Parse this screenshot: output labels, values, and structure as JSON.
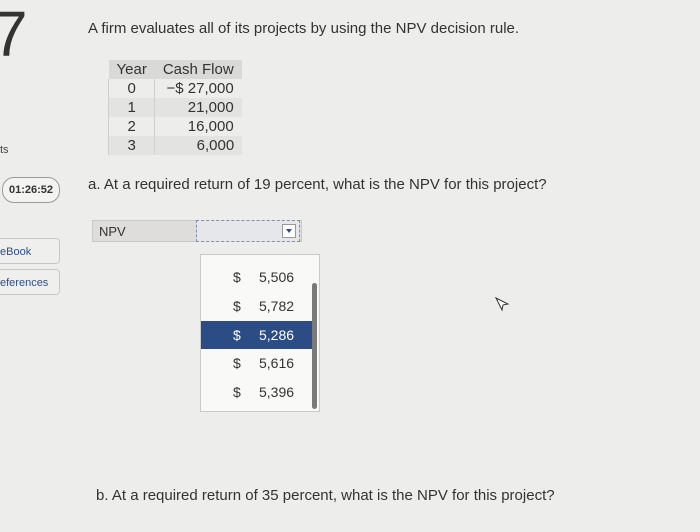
{
  "sidebar": {
    "question_number": "7",
    "partial_label": "ts",
    "timer": "01:26:52",
    "ebook_label": "eBook",
    "references_label": "eferences"
  },
  "question": {
    "text": "A firm evaluates all of its projects by using the NPV decision rule.",
    "table": {
      "headers": [
        "Year",
        "Cash Flow"
      ],
      "rows": [
        {
          "year": "0",
          "cash_flow": "−$ 27,000"
        },
        {
          "year": "1",
          "cash_flow": "21,000"
        },
        {
          "year": "2",
          "cash_flow": "16,000"
        },
        {
          "year": "3",
          "cash_flow": "6,000"
        }
      ]
    },
    "part_a": "a. At a required return of 19 percent, what is the NPV for this project?",
    "part_b": "b. At a required return of 35 percent, what is the NPV for this project?",
    "npv_label": "NPV",
    "dropdown_options": [
      {
        "currency": "$",
        "value": "5,506",
        "selected": false
      },
      {
        "currency": "$",
        "value": "5,782",
        "selected": false
      },
      {
        "currency": "$",
        "value": "5,286",
        "selected": true
      },
      {
        "currency": "$",
        "value": "5,616",
        "selected": false
      },
      {
        "currency": "$",
        "value": "5,396",
        "selected": false
      }
    ]
  },
  "colors": {
    "selected_option": "#2c4c86",
    "link": "#2a4f8f",
    "background": "#ededeb"
  }
}
